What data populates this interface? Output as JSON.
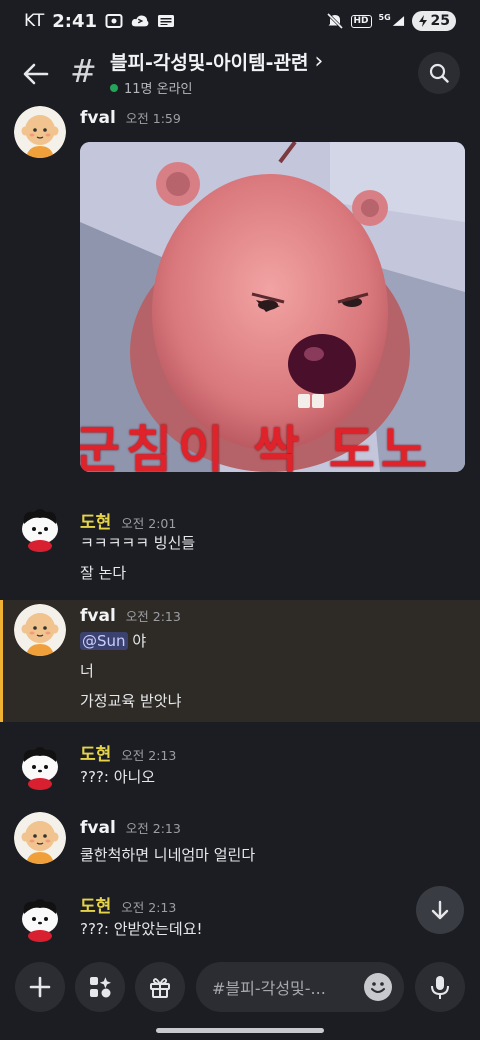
{
  "status_bar": {
    "carrier": "KT",
    "time": "2:41",
    "hd_label": "HD",
    "network_label": "5G",
    "battery": "25",
    "icons": [
      "screen-record-icon",
      "cloud-icon",
      "news-icon",
      "mute-icon",
      "signal-icon",
      "battery-icon"
    ]
  },
  "header": {
    "channel_name": "블피-각성및-아이템-관련",
    "chevron": "›",
    "online_text": "11명 온라인"
  },
  "messages": [
    {
      "author": "fval",
      "timestamp": "오전 1:59",
      "author_color": "#f2f3f5",
      "lines": [],
      "image": {
        "caption_text": "군침이 싹 도노"
      }
    },
    {
      "author": "도현",
      "timestamp": "오전 2:01",
      "author_color": "#e5d34a",
      "lines": [
        "ㅋㅋㅋㅋㅋ 빙신들",
        "잘 논다"
      ]
    },
    {
      "author": "fval",
      "timestamp": "오전 2:13",
      "author_color": "#f2f3f5",
      "mention": "@Sun",
      "mention_suffix": " 야",
      "lines": [
        "너",
        "가정교육 받앗냐"
      ]
    },
    {
      "author": "도현",
      "timestamp": "오전 2:13",
      "author_color": "#e5d34a",
      "lines": [
        "???: 아니오"
      ]
    },
    {
      "author": "fval",
      "timestamp": "오전 2:13",
      "author_color": "#f2f3f5",
      "lines": [
        "쿨한척하면 니네엄마 얼린다"
      ]
    },
    {
      "author": "도현",
      "timestamp": "오전 2:13",
      "author_color": "#e5d34a",
      "lines": [
        "???: 안받았는데요!"
      ]
    }
  ],
  "composer": {
    "placeholder": "#블피-각성및-..."
  },
  "colors": {
    "background": "#1c1d22",
    "highlight": "#f0b232",
    "online": "#23a55a"
  }
}
